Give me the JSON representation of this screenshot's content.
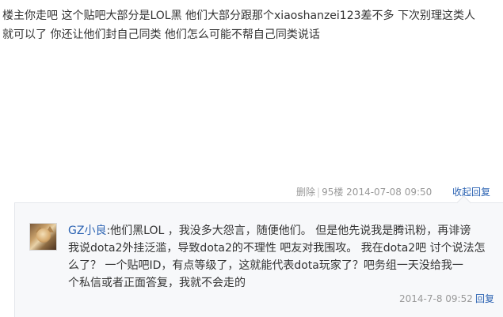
{
  "post": {
    "content_lines": [
      "楼主你走吧 这个贴吧大部分是LOL黑 他们大部分跟那个xiaoshanzei123差不多 下次别理这类人",
      "就可以了 你还让他们封自己同类 他们怎么可能不帮自己同类说话"
    ],
    "delete_label": "删除",
    "separator": "|",
    "floor": "95楼",
    "timestamp": "2014-07-08 09:50",
    "collapse_reply_label": "收起回复"
  },
  "reply": {
    "author": "GZ小良",
    "colon": ":",
    "content_lines": [
      "他们黑LOL ，我没多大怨言，随便他们。 但是他先说我是腾讯粉，再诽谤",
      "我说dota2外挂泛滥，导致dota2的不理性 吧友对我围攻。 我在dota2吧 讨个说法怎",
      "么了？ 一个贴吧ID，有点等级了，这就能代表dota玩家了？吧务组一天没给我一",
      "个私信或者正面答复，我就不会走的"
    ],
    "timestamp": "2014-7-8 09:52",
    "action_label": "回复"
  },
  "colors": {
    "link": "#2d64b3",
    "text": "#333333",
    "muted": "#999999",
    "reply_bg": "#f7f8fa",
    "reply_border": "#e4e6eb"
  }
}
